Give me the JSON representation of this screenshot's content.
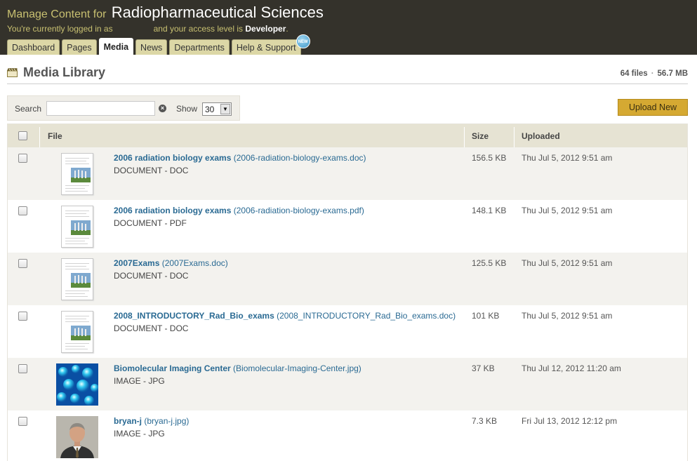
{
  "header": {
    "title_prefix": "Manage Content for",
    "site_name": "Radiopharmaceutical Sciences",
    "login_prefix": "You're currently logged in as",
    "access_prefix": "and your access level is",
    "access_level": "Developer",
    "access_suffix": ".",
    "tabs": [
      {
        "label": "Dashboard",
        "active": false
      },
      {
        "label": "Pages",
        "active": false
      },
      {
        "label": "Media",
        "active": true
      },
      {
        "label": "News",
        "active": false
      },
      {
        "label": "Departments",
        "active": false
      },
      {
        "label": "Help & Support",
        "active": false,
        "badge": "NEW"
      }
    ]
  },
  "page": {
    "title": "Media Library",
    "file_count": "64 files",
    "dot": "·",
    "total_size": "56.7 MB"
  },
  "toolbar": {
    "search_label": "Search",
    "search_value": "",
    "clear_glyph": "×",
    "show_label": "Show",
    "show_value": "30",
    "upload_label": "Upload New"
  },
  "table": {
    "columns": {
      "file": "File",
      "size": "Size",
      "uploaded": "Uploaded"
    },
    "rows": [
      {
        "title": "2006 radiation biology exams",
        "filename": "(2006-radiation-biology-exams.doc)",
        "type": "DOCUMENT - DOC",
        "size": "156.5 KB",
        "uploaded": "Thu Jul 5, 2012 9:51 am",
        "thumb": "document-thumbnail"
      },
      {
        "title": "2006 radiation biology exams",
        "filename": "(2006-radiation-biology-exams.pdf)",
        "type": "DOCUMENT - PDF",
        "size": "148.1 KB",
        "uploaded": "Thu Jul 5, 2012 9:51 am",
        "thumb": "document-thumbnail"
      },
      {
        "title": "2007Exams",
        "filename": "(2007Exams.doc)",
        "type": "DOCUMENT - DOC",
        "size": "125.5 KB",
        "uploaded": "Thu Jul 5, 2012 9:51 am",
        "thumb": "document-thumbnail"
      },
      {
        "title": "2008_INTRODUCTORY_Rad_Bio_exams",
        "filename": "(2008_INTRODUCTORY_Rad_Bio_exams.doc)",
        "type": "DOCUMENT - DOC",
        "size": "101 KB",
        "uploaded": "Thu Jul 5, 2012 9:51 am",
        "thumb": "document-thumbnail"
      },
      {
        "title": "Biomolecular Imaging Center",
        "filename": "(Biomolecular-Imaging-Center.jpg)",
        "type": "IMAGE - JPG",
        "size": "37 KB",
        "uploaded": "Thu Jul 12, 2012 11:20 am",
        "thumb": "molecule-image-thumbnail"
      },
      {
        "title": "bryan-j",
        "filename": "(bryan-j.jpg)",
        "type": "IMAGE - JPG",
        "size": "7.3 KB",
        "uploaded": "Fri Jul 13, 2012 12:12 pm",
        "thumb": "portrait-image-thumbnail"
      }
    ]
  },
  "colors": {
    "topbar": "#34322b",
    "header_text": "#c8c071",
    "tab": "#dcd7a6",
    "link": "#2a6a93",
    "upload_button": "#d5a932",
    "table_header": "#e6e3d3",
    "row_alt": "#f3f2ee"
  }
}
